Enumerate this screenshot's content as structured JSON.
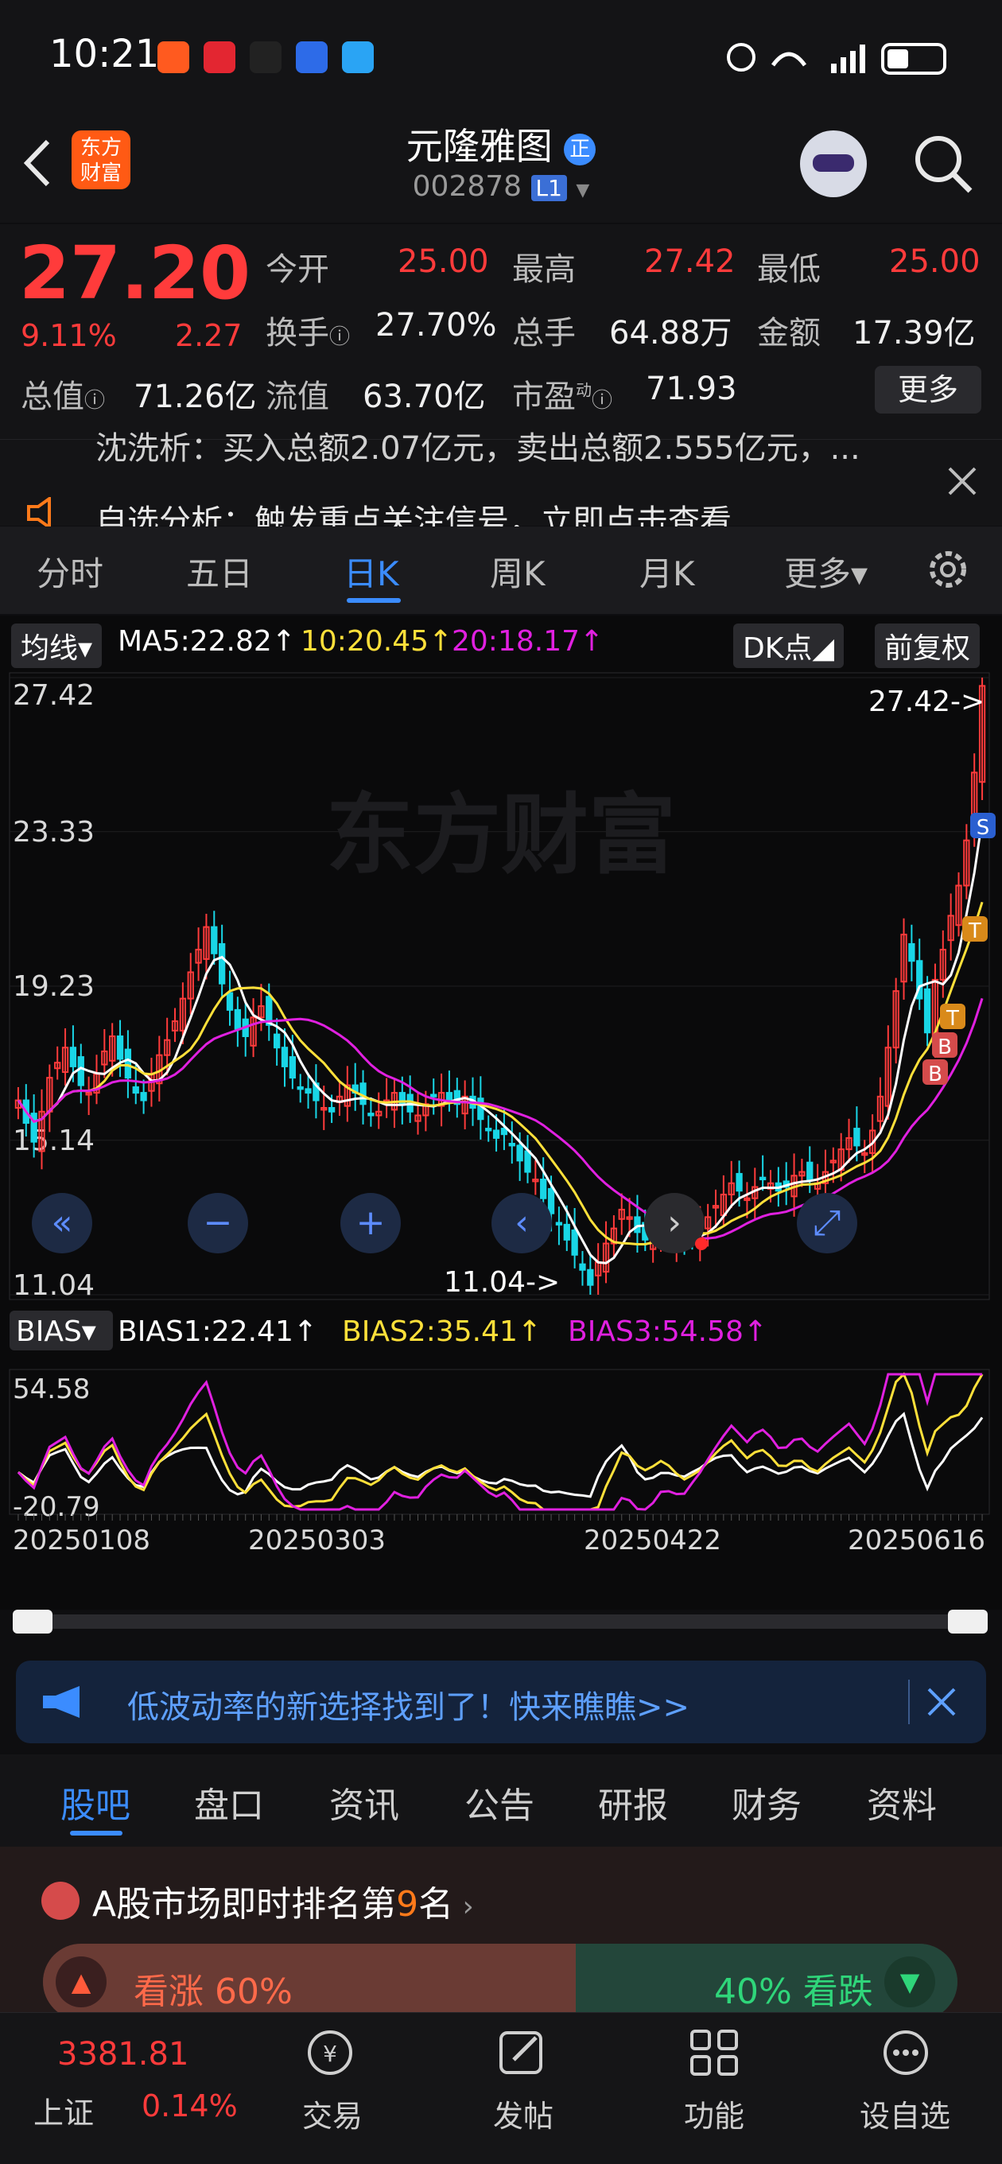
{
  "status_bar": {
    "time": "10:21"
  },
  "header": {
    "title": "元隆雅图",
    "code": "002878",
    "level": "L1",
    "logo_line1": "东方",
    "logo_line2": "财富",
    "badge": "正"
  },
  "quote": {
    "price": "27.20",
    "change_pct": "9.11%",
    "change": "2.27",
    "open_label": "今开",
    "open": "25.00",
    "high_label": "最高",
    "high": "27.42",
    "low_label": "最低",
    "low": "25.00",
    "turnover_label": "换手",
    "turnover": "27.70%",
    "volume_label": "总手",
    "volume": "64.88万",
    "amount_label": "金额",
    "amount": "17.39亿",
    "mktcap_label": "总值",
    "mktcap": "71.26亿",
    "float_label": "流值",
    "float_cap": "63.70亿",
    "pe_label": "市盈",
    "pe_sup": "动",
    "pe": "71.93",
    "more_label": "更多"
  },
  "news": {
    "line1": "沈洗析：买入总额2.07亿元，卖出总额2.555亿元，...",
    "line2": "自选分析：触发重点关注信号，立即点击查看"
  },
  "period_tabs": [
    "分时",
    "五日",
    "日K",
    "周K",
    "月K",
    "更多▾"
  ],
  "active_tab": "日K",
  "ma_bar": {
    "selector": "均线",
    "ma5": "MA5:22.82↑",
    "ma10": "10:20.45↑",
    "ma20": "20:18.17↑",
    "dk": "DK点",
    "adjust": "前复权"
  },
  "chart_watermark": "东方财富",
  "chart_data": {
    "type": "candlestick",
    "y_ticks": [
      "27.42",
      "23.33",
      "19.23",
      "15.14",
      "11.04"
    ],
    "ylim": [
      11.04,
      27.42
    ],
    "max_label": "27.42->",
    "min_label": "11.04->",
    "x_ticks": [
      "20250108",
      "20250303",
      "20250422",
      "20250616"
    ],
    "closes": [
      16.2,
      15.6,
      15.1,
      15.9,
      16.8,
      17.2,
      17.6,
      17.1,
      16.6,
      16.4,
      16.9,
      17.5,
      17.9,
      17.3,
      16.8,
      16.4,
      16.2,
      16.9,
      17.4,
      17.8,
      18.3,
      18.9,
      19.6,
      20.2,
      20.8,
      20.1,
      19.3,
      18.6,
      18.1,
      17.9,
      18.4,
      18.7,
      18.2,
      17.6,
      17.1,
      16.8,
      16.5,
      16.4,
      16.2,
      16.0,
      15.9,
      16.3,
      16.6,
      16.4,
      16.1,
      15.8,
      15.9,
      16.2,
      16.4,
      16.1,
      15.9,
      15.8,
      16.1,
      16.3,
      16.4,
      16.2,
      16.1,
      16.3,
      16.0,
      15.7,
      15.4,
      15.2,
      15.3,
      15.0,
      14.6,
      14.3,
      14.1,
      13.6,
      13.2,
      12.9,
      12.5,
      12.1,
      11.7,
      11.3,
      11.9,
      12.4,
      12.8,
      13.3,
      13.1,
      12.7,
      12.5,
      12.6,
      12.8,
      12.7,
      12.5,
      12.4,
      12.6,
      12.8,
      13.1,
      13.4,
      13.7,
      14.0,
      13.8,
      13.6,
      13.9,
      14.1,
      14.0,
      13.8,
      13.9,
      14.2,
      14.3,
      14.1,
      14.0,
      14.3,
      14.6,
      14.9,
      15.2,
      15.0,
      14.8,
      15.4,
      16.3,
      17.6,
      19.1,
      20.6,
      19.9,
      18.9,
      18.0,
      19.4,
      20.2,
      21.1,
      21.9,
      23.1,
      24.9,
      27.2
    ],
    "bias_labels": {
      "selector": "BIAS",
      "bias1": "BIAS1:22.41↑",
      "bias2": "BIAS2:35.41↑",
      "bias3": "BIAS3:54.58↑"
    },
    "bias_ticks": [
      "54.58",
      "-20.79"
    ],
    "bias_range": [
      -20.79,
      54.58
    ]
  },
  "colors": {
    "up": "#ff3b3b",
    "down": "#19d6e6",
    "ma5": "#ffffff",
    "ma10": "#ffe03a",
    "ma20": "#e020e0",
    "accent": "#3b8cff"
  },
  "banner": {
    "text": "低波动率的新选择找到了！快来瞧瞧>>"
  },
  "bottom_tabs": [
    "股吧",
    "盘口",
    "资讯",
    "公告",
    "研报",
    "财务",
    "资料"
  ],
  "ranking": {
    "prefix": "A股市场即时排名第",
    "rank": "9",
    "suffix": "名",
    "up_label": "看涨 60%",
    "down_label": "40% 看跌",
    "up_pct": 0.6
  },
  "index": {
    "value": "3381.81",
    "name": "上证",
    "pct": "0.14%"
  },
  "nav": [
    "交易",
    "发帖",
    "功能",
    "设自选"
  ]
}
